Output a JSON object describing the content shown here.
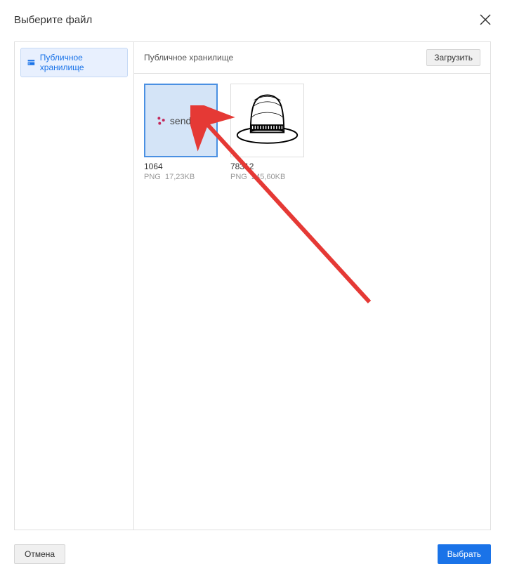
{
  "modal": {
    "title": "Выберите файл"
  },
  "sidebar": {
    "items": [
      {
        "label": "Публичное хранилище"
      }
    ]
  },
  "content": {
    "breadcrumb": "Публичное хранилище",
    "upload_label": "Загрузить"
  },
  "files": [
    {
      "name": "1064",
      "type": "PNG",
      "size": "17,23KB",
      "selected": true,
      "thumb": "sendsay"
    },
    {
      "name": "78312",
      "type": "PNG",
      "size": "245,60KB",
      "selected": false,
      "thumb": "hat"
    }
  ],
  "footer": {
    "cancel_label": "Отмена",
    "select_label": "Выбрать"
  }
}
